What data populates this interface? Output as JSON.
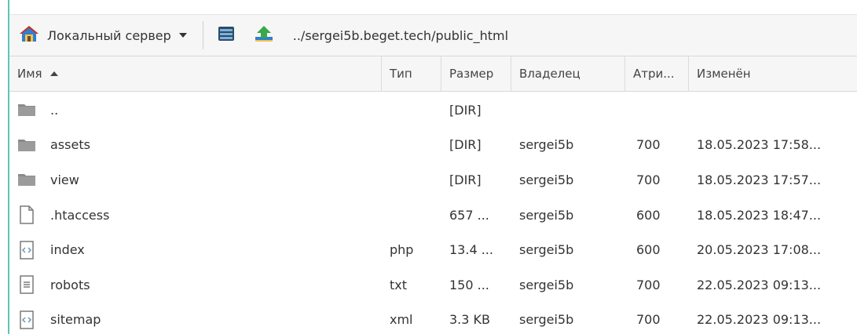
{
  "toolbar": {
    "server_label": "Локальный сервер",
    "path": "../sergei5b.beget.tech/public_html"
  },
  "columns": {
    "name": "Имя",
    "type": "Тип",
    "size": "Размер",
    "owner": "Владелец",
    "attr": "Атри...",
    "modified": "Изменён"
  },
  "files": [
    {
      "name": "..",
      "type": "",
      "size": "[DIR]",
      "owner": "",
      "attr": "",
      "modified": "",
      "icon": "folder-icon"
    },
    {
      "name": "assets",
      "type": "",
      "size": "[DIR]",
      "owner": "sergei5b",
      "attr": "700",
      "modified": "18.05.2023 17:58...",
      "icon": "folder-icon"
    },
    {
      "name": "view",
      "type": "",
      "size": "[DIR]",
      "owner": "sergei5b",
      "attr": "700",
      "modified": "18.05.2023 17:57...",
      "icon": "folder-icon"
    },
    {
      "name": ".htaccess",
      "type": "",
      "size": "657 ...",
      "owner": "sergei5b",
      "attr": "600",
      "modified": "18.05.2023 18:47...",
      "icon": "blank-file-icon"
    },
    {
      "name": "index",
      "type": "php",
      "size": "13.4 ...",
      "owner": "sergei5b",
      "attr": "600",
      "modified": "20.05.2023 17:08...",
      "icon": "code-file-icon"
    },
    {
      "name": "robots",
      "type": "txt",
      "size": "150 ...",
      "owner": "sergei5b",
      "attr": "700",
      "modified": "22.05.2023 09:13...",
      "icon": "text-file-icon"
    },
    {
      "name": "sitemap",
      "type": "xml",
      "size": "3.3 KB",
      "owner": "sergei5b",
      "attr": "700",
      "modified": "22.05.2023 09:13...",
      "icon": "code-file-icon"
    }
  ],
  "colors": {
    "accent": "#5fc4b9",
    "header_bg": "#f6f6f6",
    "folder": "#8a8a8a"
  }
}
